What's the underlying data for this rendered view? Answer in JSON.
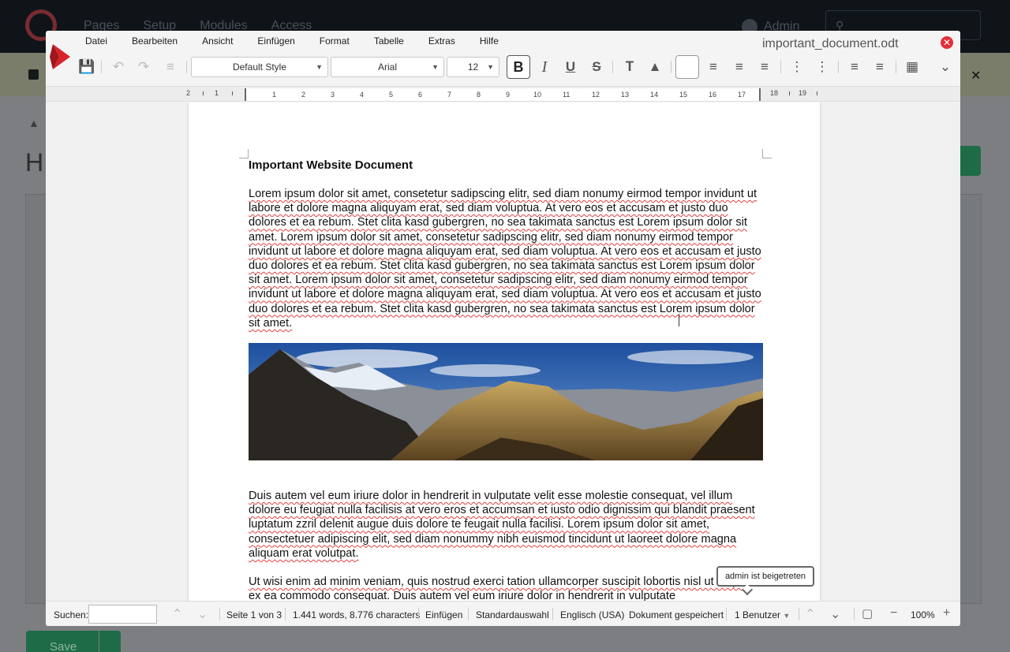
{
  "background": {
    "nav": [
      "Pages",
      "Setup",
      "Modules",
      "Access"
    ],
    "user": "Admin",
    "heading": "H",
    "save_label": "Save"
  },
  "editor": {
    "menu": [
      "Datei",
      "Bearbeiten",
      "Ansicht",
      "Einfügen",
      "Format",
      "Tabelle",
      "Extras",
      "Hilfe"
    ],
    "title": "important_document.odt",
    "paragraph_style": "Default Style",
    "font_name": "Arial",
    "font_size": "12",
    "bold_label": "B",
    "italic_label": "I",
    "underline_label": "U",
    "strike_label": "S",
    "ruler_left": [
      "2",
      "1"
    ],
    "ruler_main": [
      "1",
      "2",
      "3",
      "4",
      "5",
      "6",
      "7",
      "8",
      "9",
      "10",
      "11",
      "12",
      "13",
      "14",
      "15",
      "16",
      "17"
    ],
    "ruler_right": [
      "18",
      "19"
    ]
  },
  "document": {
    "heading": "Important Website Document",
    "paragraph1": "Lorem ipsum dolor sit amet, consetetur sadipscing elitr, sed diam nonumy eirmod tempor invidunt ut labore et dolore magna aliquyam erat, sed diam voluptua. At vero eos et accusam et justo duo dolores et ea rebum. Stet clita kasd gubergren, no sea takimata sanctus est Lorem ipsum dolor sit amet. Lorem ipsum dolor sit amet, consetetur sadipscing elitr, sed diam nonumy eirmod tempor invidunt ut labore et dolore magna aliquyam erat, sed diam voluptua. At vero eos et accusam et justo duo dolores et ea rebum. Stet clita kasd gubergren, no sea takimata sanctus est Lorem ipsum dolor sit amet. Lorem ipsum dolor sit amet, consetetur sadipscing elitr, sed diam nonumy eirmod tempor invidunt ut labore et dolore magna aliquyam erat, sed diam voluptua. At vero eos et accusam et justo duo dolores et ea rebum. Stet clita kasd gubergren, no sea takimata sanctus est Lorem ipsum dolor sit amet.",
    "paragraph2": "Duis autem vel eum iriure dolor in hendrerit in vulputate velit esse molestie consequat, vel illum dolore eu feugiat nulla facilisis at vero eros et accumsan et iusto odio dignissim qui blandit praesent luptatum zzril delenit augue duis dolore te feugait nulla facilisi. Lorem ipsum dolor sit amet, consectetuer adipiscing elit, sed diam nonummy nibh euismod tincidunt ut laoreet dolore magna aliquam erat volutpat.",
    "paragraph3": "Ut wisi enim ad minim veniam, quis nostrud exerci tation ullamcorper suscipit lobortis nisl ut aliquip ex ea commodo consequat. Duis autem vel eum iriure dolor in hendrerit in vulputate"
  },
  "tooltip": "admin ist beigetreten",
  "status": {
    "search_label": "Suchen:",
    "page": "Seite 1 von 3",
    "counts": "1.441 words, 8.776 characters",
    "insert_mode": "Einfügen",
    "selection_mode": "Standardauswahl",
    "language": "Englisch (USA)",
    "save_state": "Dokument gespeichert",
    "users": "1 Benutzer",
    "zoom": "100%"
  }
}
